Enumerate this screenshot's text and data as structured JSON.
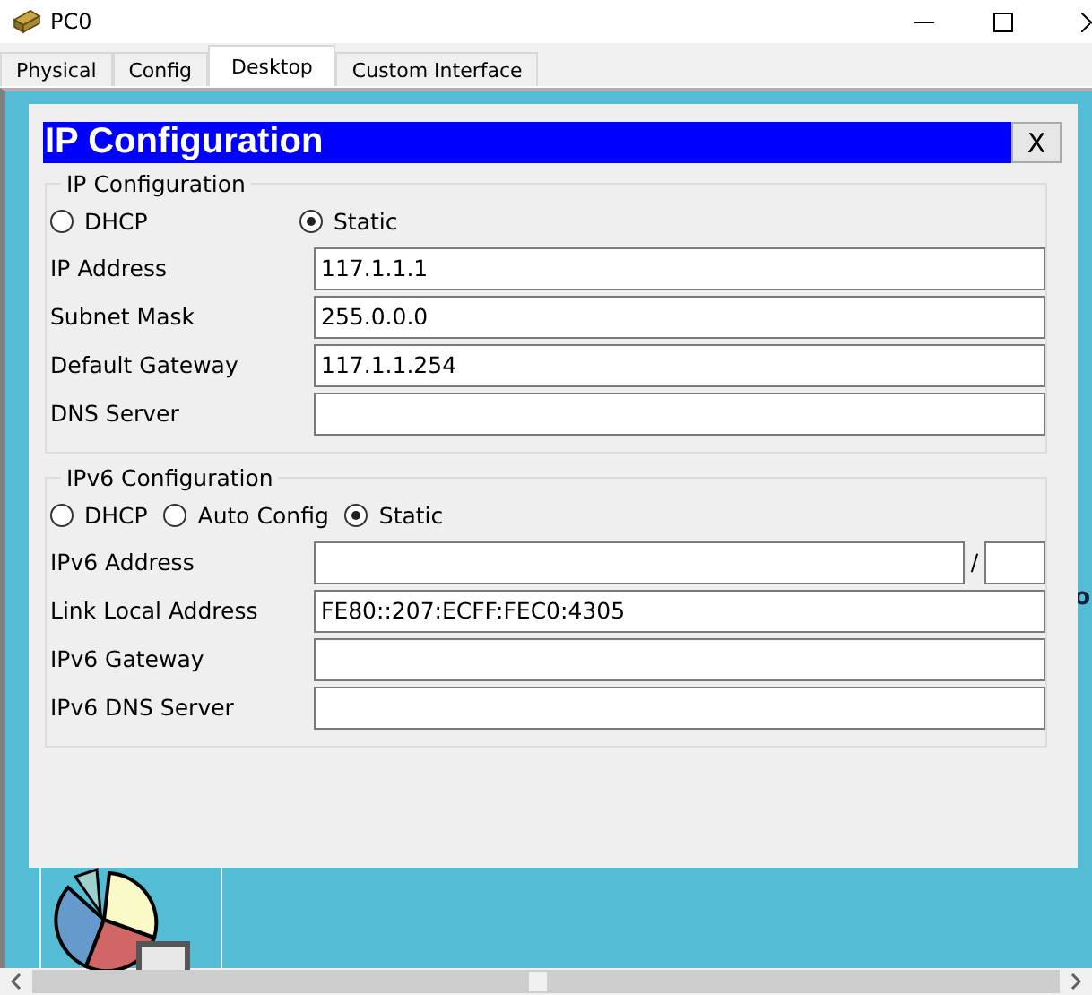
{
  "window": {
    "title": "PC0"
  },
  "tabs": [
    {
      "label": "Physical",
      "selected": false
    },
    {
      "label": "Config",
      "selected": false
    },
    {
      "label": "Desktop",
      "selected": true
    },
    {
      "label": "Custom Interface",
      "selected": false
    }
  ],
  "dialog": {
    "title": "IP Configuration",
    "close": "X",
    "sections": [
      {
        "legend": "IP Configuration",
        "modes": [
          {
            "label": "DHCP",
            "selected": false
          },
          {
            "label": "Static",
            "selected": true
          }
        ],
        "fields": [
          {
            "kind": "text",
            "label": "IP Address",
            "value": "117.1.1.1"
          },
          {
            "kind": "text",
            "label": "Subnet Mask",
            "value": "255.0.0.0"
          },
          {
            "kind": "text",
            "label": "Default Gateway",
            "value": "117.1.1.254"
          },
          {
            "kind": "text",
            "label": "DNS Server"
          }
        ]
      },
      {
        "legend": "IPv6 Configuration",
        "modes": [
          {
            "label": "DHCP",
            "selected": false
          },
          {
            "label": "Auto Config",
            "selected": false
          },
          {
            "label": "Static",
            "selected": true
          }
        ],
        "fields": [
          {
            "kind": "prefixed",
            "label": "IPv6 Address",
            "separator": "/"
          },
          {
            "kind": "text",
            "label": "Link Local Address",
            "value": "FE80::207:ECFF:FEC0:4305"
          },
          {
            "kind": "text",
            "label": "IPv6 Gateway"
          },
          {
            "kind": "text",
            "label": "IPv6 DNS Server"
          }
        ]
      }
    ]
  },
  "behind_text": "o"
}
